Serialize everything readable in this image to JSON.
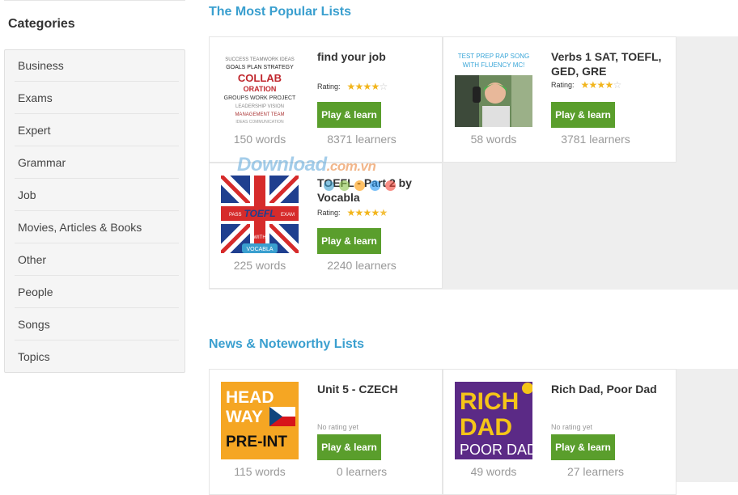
{
  "sidebar": {
    "heading": "Categories",
    "items": [
      "Business",
      "Exams",
      "Expert",
      "Grammar",
      "Job",
      "Movies, Articles & Books",
      "Other",
      "People",
      "Songs",
      "Topics"
    ]
  },
  "popular": {
    "heading": "The Most Popular Lists",
    "cards": [
      {
        "title": "find your job",
        "rating_label": "Rating:",
        "rating": 4,
        "play": "Play & learn",
        "words": "150 words",
        "learners": "8371 learners",
        "thumb_text": "COLLABORATION"
      },
      {
        "title": "Verbs 1 SAT, TOEFL, GED, GRE",
        "rating_label": "Rating:",
        "rating": 4,
        "play": "Play & learn",
        "words": "58 words",
        "learners": "3781 learners",
        "thumb_text": "TEST PREP RAP SONG WITH FLUENCY MC!"
      },
      {
        "title": "TOEFL - Part 2 by Vocabla",
        "rating_label": "Rating:",
        "rating": 4.5,
        "play": "Play & learn",
        "words": "225 words",
        "learners": "2240 learners",
        "thumb_text": "PASS TOEFL EXAM WITH VOCABLA"
      }
    ]
  },
  "news": {
    "heading": "News & Noteworthy Lists",
    "cards": [
      {
        "title": "Unit 5 - CZECH",
        "rating_text": "No rating yet",
        "play": "Play & learn",
        "words": "115 words",
        "learners": "0 learners",
        "thumb_text": "HEAD WAY PRE-INT"
      },
      {
        "title": "Rich Dad, Poor Dad",
        "rating_text": "No rating yet",
        "play": "Play & learn",
        "words": "49 words",
        "learners": "27 learners",
        "thumb_text": "RICH DAD POOR DAD"
      }
    ]
  },
  "watermark": {
    "main": "Download",
    "suffix": ".com.vn"
  },
  "colors": {
    "accent": "#3a9fcf",
    "button": "#5a9e2c",
    "star": "#f2b51c"
  }
}
